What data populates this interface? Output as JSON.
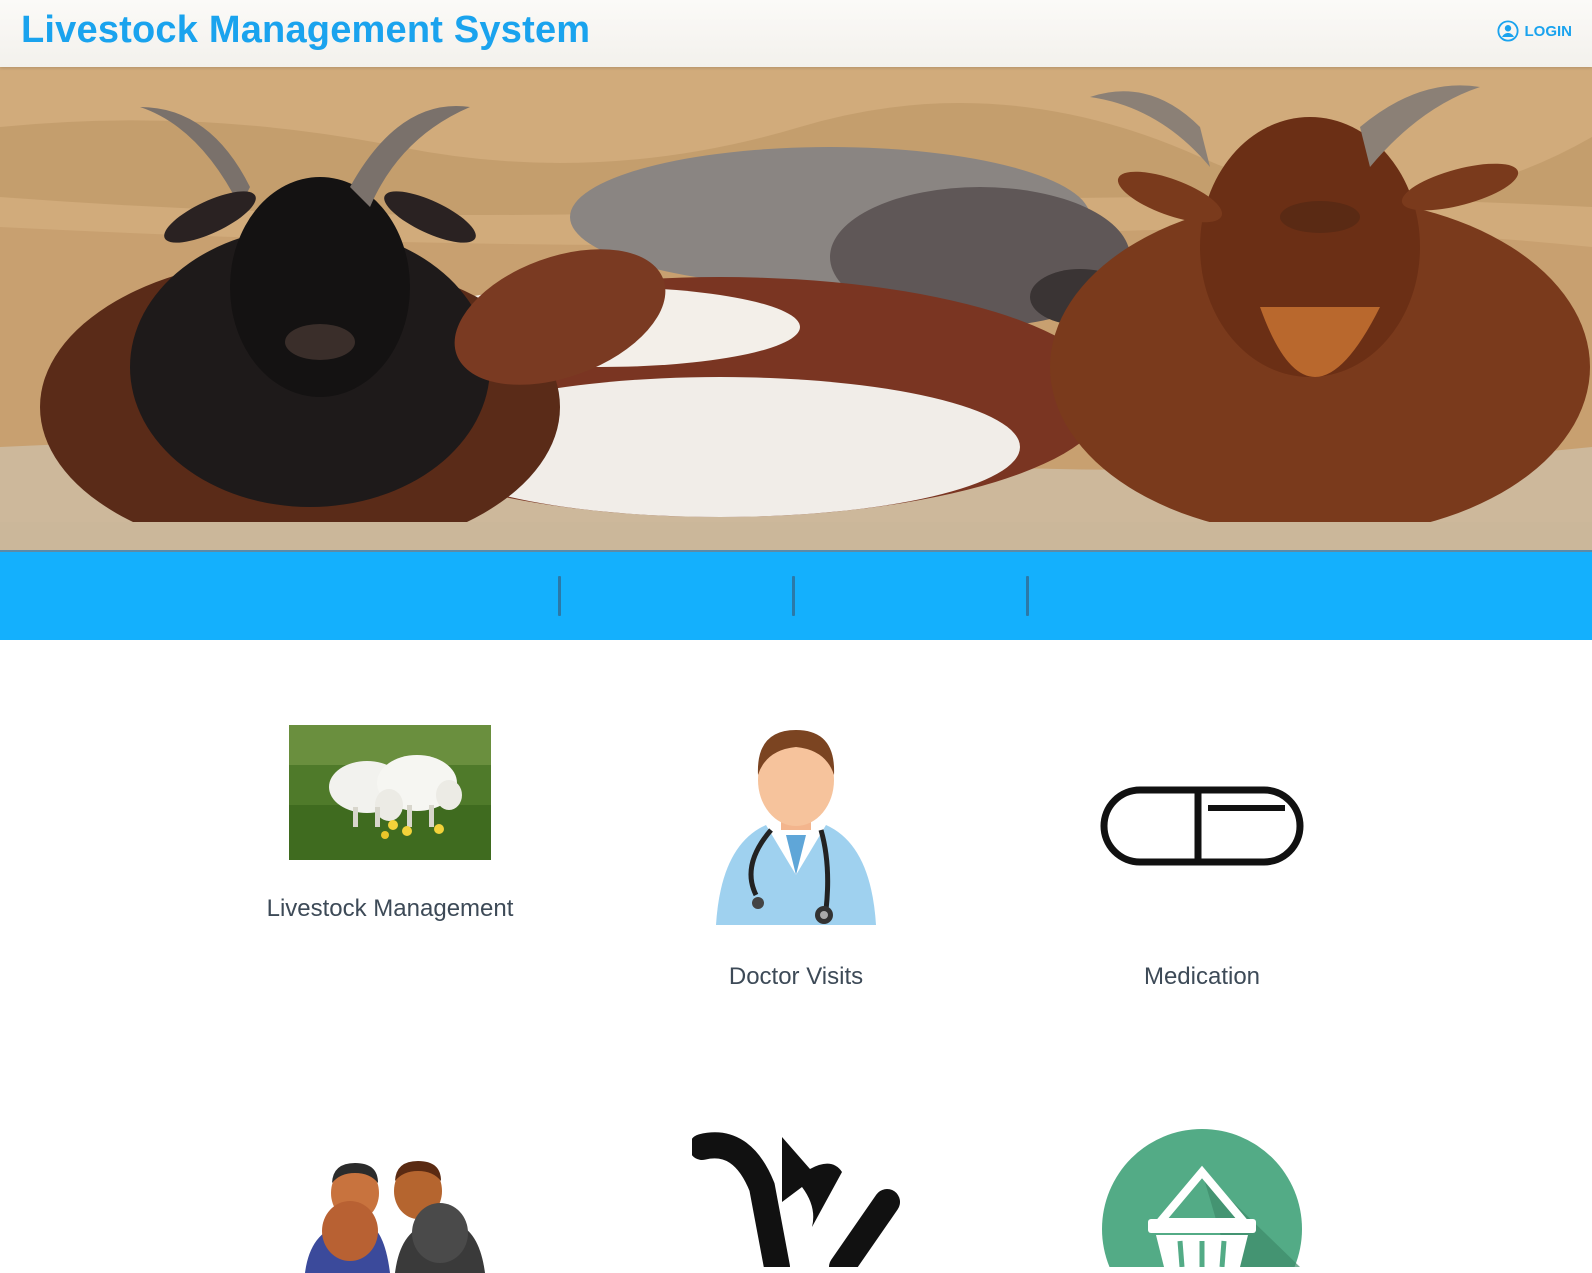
{
  "header": {
    "title": "Livestock Management System",
    "login_label": "LOGIN"
  },
  "colors": {
    "brand": "#1aa3ee",
    "bar": "#14b0fd",
    "label": "#3d4a57"
  },
  "hero": {
    "slides": 1,
    "active_slide": 1
  },
  "tiles": [
    {
      "label": "Livestock Management",
      "icon": "sheep-photo"
    },
    {
      "label": "Doctor Visits",
      "icon": "doctor-icon"
    },
    {
      "label": "Medication",
      "icon": "pill-icon"
    },
    {
      "label": "",
      "icon": "users-icon"
    },
    {
      "label": "",
      "icon": "transfer-arrows-icon"
    },
    {
      "label": "",
      "icon": "basket-icon"
    }
  ]
}
